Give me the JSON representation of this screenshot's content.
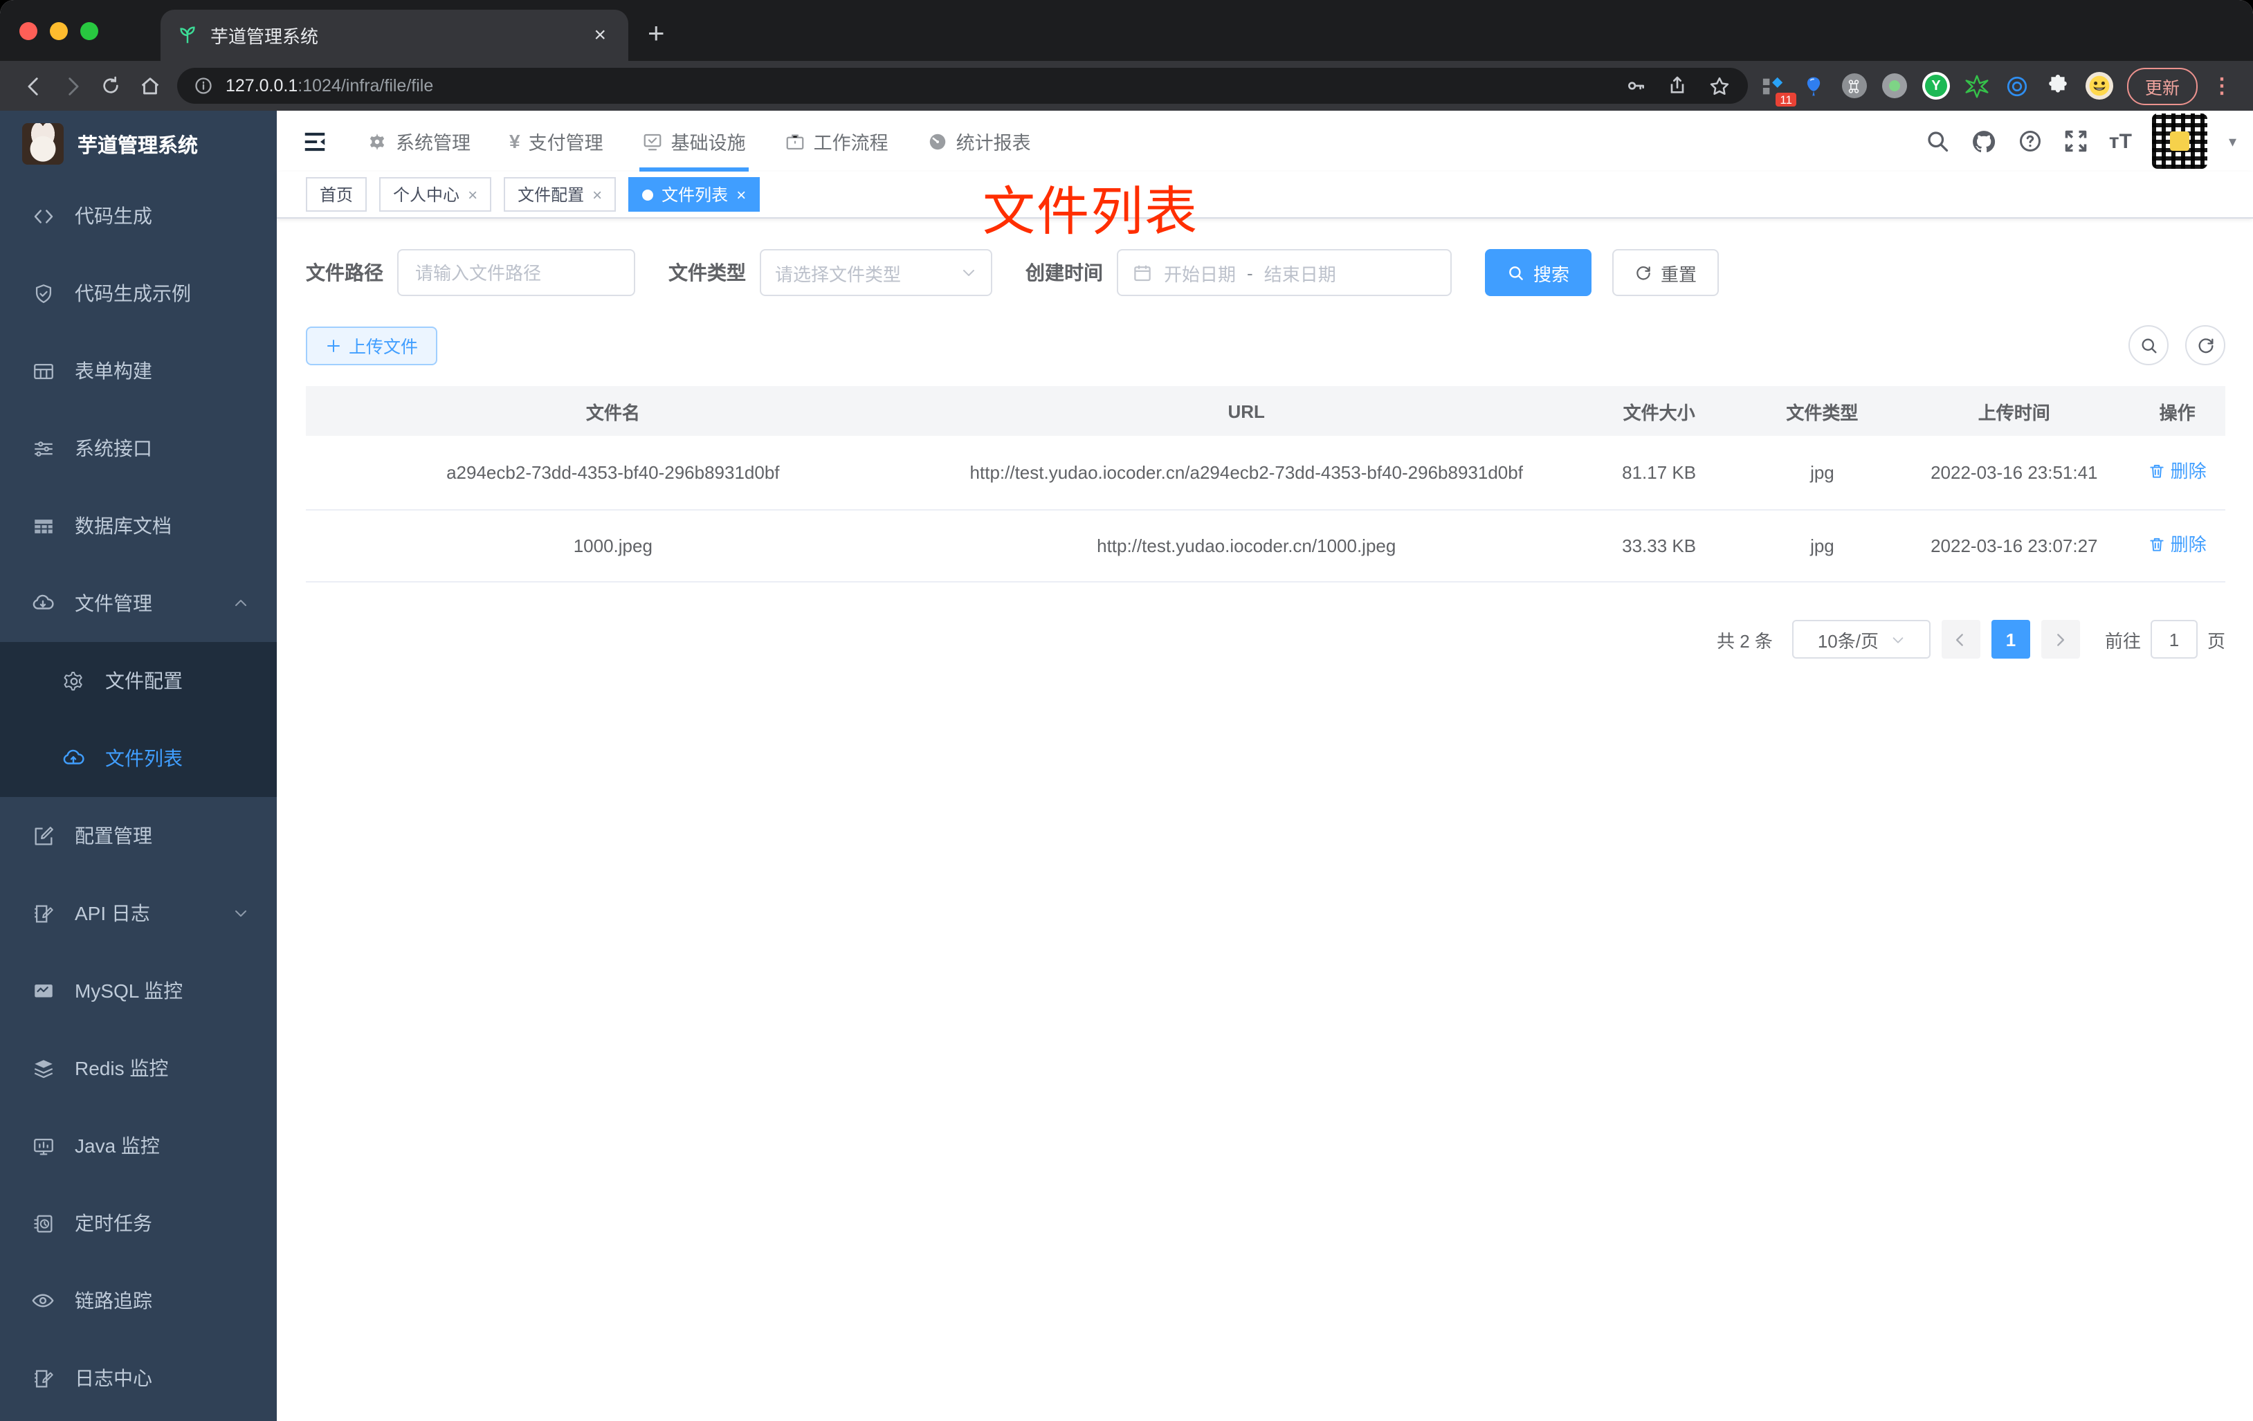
{
  "colors": {
    "primary": "#409eff",
    "annotation_red": "#ff2e00",
    "sidebar_bg": "#304156",
    "submenu_bg": "#1f2d3d",
    "sidebar_text": "#bfcbd9",
    "update_pill": "#ec928e"
  },
  "icons": {
    "close": "×",
    "plus": "+",
    "dots": "⋮",
    "caret_down": "▾",
    "yen": "¥"
  },
  "browser": {
    "tab": {
      "title": "芋道管理系统"
    },
    "url": {
      "host": "127.0.0.1",
      "rest": ":1024/infra/file/file"
    },
    "extension_badge": "11",
    "extension_y_label": "Y",
    "update_button": "更新"
  },
  "sidebar": {
    "title": "芋道管理系统",
    "items": [
      {
        "label": "代码生成"
      },
      {
        "label": "代码生成示例"
      },
      {
        "label": "表单构建"
      },
      {
        "label": "系统接口"
      },
      {
        "label": "数据库文档"
      },
      {
        "label": "文件管理"
      },
      {
        "label": "文件配置"
      },
      {
        "label": "文件列表"
      },
      {
        "label": "配置管理"
      },
      {
        "label": "API 日志"
      },
      {
        "label": "MySQL 监控"
      },
      {
        "label": "Redis 监控"
      },
      {
        "label": "Java 监控"
      },
      {
        "label": "定时任务"
      },
      {
        "label": "链路追踪"
      },
      {
        "label": "日志中心"
      }
    ]
  },
  "header": {
    "nav": [
      {
        "label": "系统管理"
      },
      {
        "label": "支付管理"
      },
      {
        "label": "基础设施"
      },
      {
        "label": "工作流程"
      },
      {
        "label": "统计报表"
      }
    ]
  },
  "tags": [
    {
      "label": "首页"
    },
    {
      "label": "个人中心"
    },
    {
      "label": "文件配置"
    },
    {
      "label": "文件列表"
    }
  ],
  "annotation": {
    "text": "文件列表"
  },
  "filters": {
    "path_label": "文件路径",
    "path_placeholder": "请输入文件路径",
    "type_label": "文件类型",
    "type_placeholder": "请选择文件类型",
    "date_label": "创建时间",
    "date_start": "开始日期",
    "date_separator": "-",
    "date_end": "结束日期",
    "search_label": "搜索",
    "reset_label": "重置"
  },
  "toolbar": {
    "upload_label": "上传文件"
  },
  "table": {
    "columns": [
      "文件名",
      "URL",
      "文件大小",
      "文件类型",
      "上传时间",
      "操作"
    ],
    "rows": [
      {
        "name": "a294ecb2-73dd-4353-bf40-296b8931d0bf",
        "url": "http://test.yudao.iocoder.cn/a294ecb2-73dd-4353-bf40-296b8931d0bf",
        "size": "81.17 KB",
        "type": "jpg",
        "time": "2022-03-16 23:51:41",
        "action": "删除"
      },
      {
        "name": "1000.jpeg",
        "url": "http://test.yudao.iocoder.cn/1000.jpeg",
        "size": "33.33 KB",
        "type": "jpg",
        "time": "2022-03-16 23:07:27",
        "action": "删除"
      }
    ]
  },
  "pagination": {
    "total": "共 2 条",
    "page_size": "10条/页",
    "current": "1",
    "goto_prefix": "前往",
    "goto_value": "1",
    "goto_suffix": "页"
  }
}
